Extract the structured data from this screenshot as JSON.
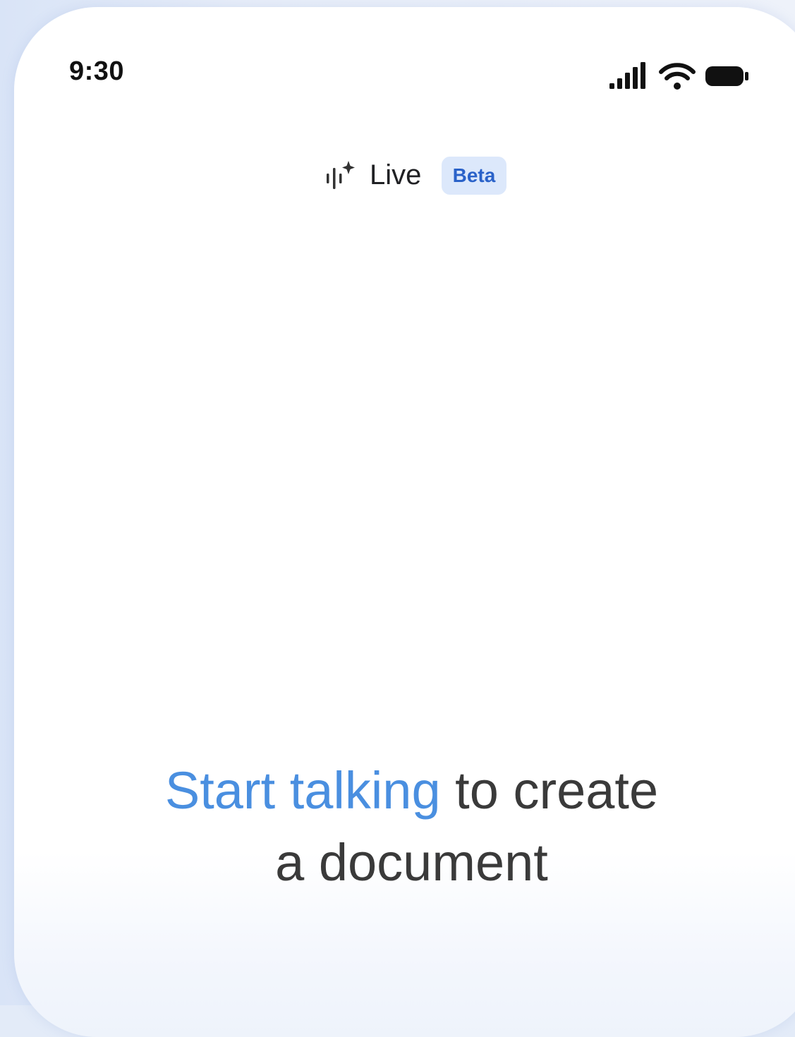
{
  "status_bar": {
    "time": "9:30",
    "icons": [
      "signal-icon",
      "wifi-icon",
      "battery-icon"
    ]
  },
  "header": {
    "title": "Live",
    "badge": "Beta",
    "icon": "live-waveform-sparkle-icon"
  },
  "prompt": {
    "highlight": "Start talking",
    "rest_line1": " to create",
    "line2": "a document"
  },
  "colors": {
    "accent": "#4a8fe0",
    "badge_bg": "#dce8fb",
    "badge_text": "#2a62c9",
    "text": "#3a3a3a"
  }
}
